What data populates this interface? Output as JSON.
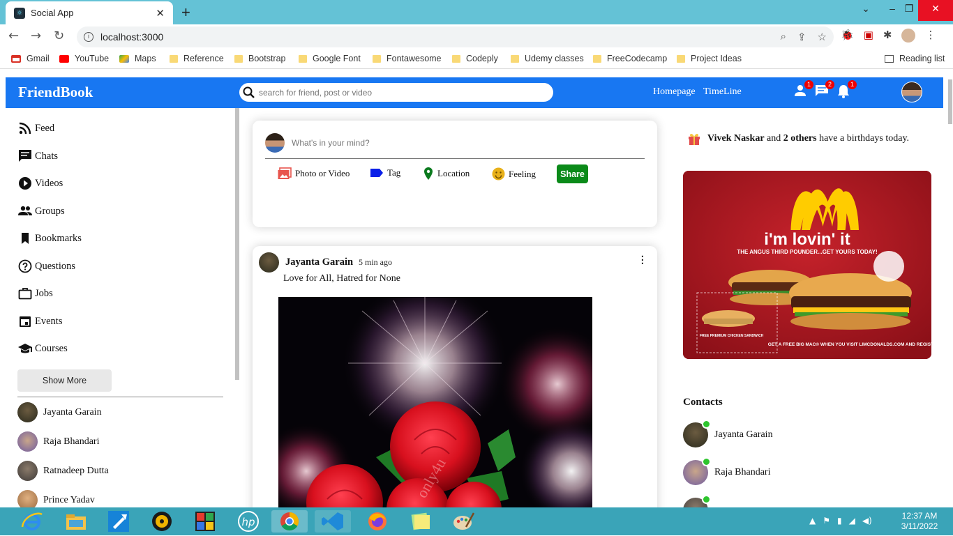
{
  "browser": {
    "tab_title": "Social App",
    "tab_close": "✕",
    "new_tab": "+",
    "url": "localhost:3000",
    "bookmarks": [
      "Gmail",
      "YouTube",
      "Maps",
      "Reference",
      "Bootstrap",
      "Google Font",
      "Fontawesome",
      "Codeply",
      "Udemy classes",
      "FreeCodecamp",
      "Project Ideas"
    ],
    "reading_list": "Reading list"
  },
  "topbar": {
    "logo": "FriendBook",
    "search_placeholder": "search for friend, post or video",
    "links": [
      "Homepage",
      "TimeLine"
    ],
    "badges": {
      "friends": "1",
      "messages": "2",
      "notifications": "1"
    }
  },
  "sidebar": {
    "items": [
      "Feed",
      "Chats",
      "Videos",
      "Groups",
      "Bookmarks",
      "Questions",
      "Jobs",
      "Events",
      "Courses"
    ],
    "show_more": "Show More",
    "friends": [
      "Jayanta Garain",
      "Raja Bhandari",
      "Ratnadeep Dutta",
      "Prince Yadav"
    ]
  },
  "share": {
    "placeholder": "What's in your mind?",
    "options": [
      "Photo or Video",
      "Tag",
      "Location",
      "Feeling"
    ],
    "share_button": "Share"
  },
  "post": {
    "author": "Jayanta Garain",
    "time": "5 min ago",
    "text": "Love for All, Hatred for None",
    "watermark": "only4u"
  },
  "rightbar": {
    "birthday_name": "Vivek Naskar",
    "birthday_and": "and",
    "birthday_others": "2 others",
    "birthday_tail": "have a birthdays today.",
    "ad": {
      "slogan": "i'm lovin' it",
      "headline": "THE ANGUS THIRD POUNDER...GET YOURS TODAY!",
      "footer": "GET A FREE BIG MAC® WHEN YOU VISIT LIMCDONALDS.COM AND REGISTER!",
      "coupon": "FREE PREMIUM CHICKEN SANDWICH"
    },
    "contacts_title": "Contacts",
    "contacts": [
      "Jayanta Garain",
      "Raja Bhandari"
    ]
  },
  "taskbar": {
    "time": "12:37 AM",
    "date": "3/11/2022"
  },
  "colors": {
    "brand": "#1877f2",
    "share_green": "#0b8a19",
    "badge_red": "#ee0000",
    "online_green": "#2ec52e"
  }
}
